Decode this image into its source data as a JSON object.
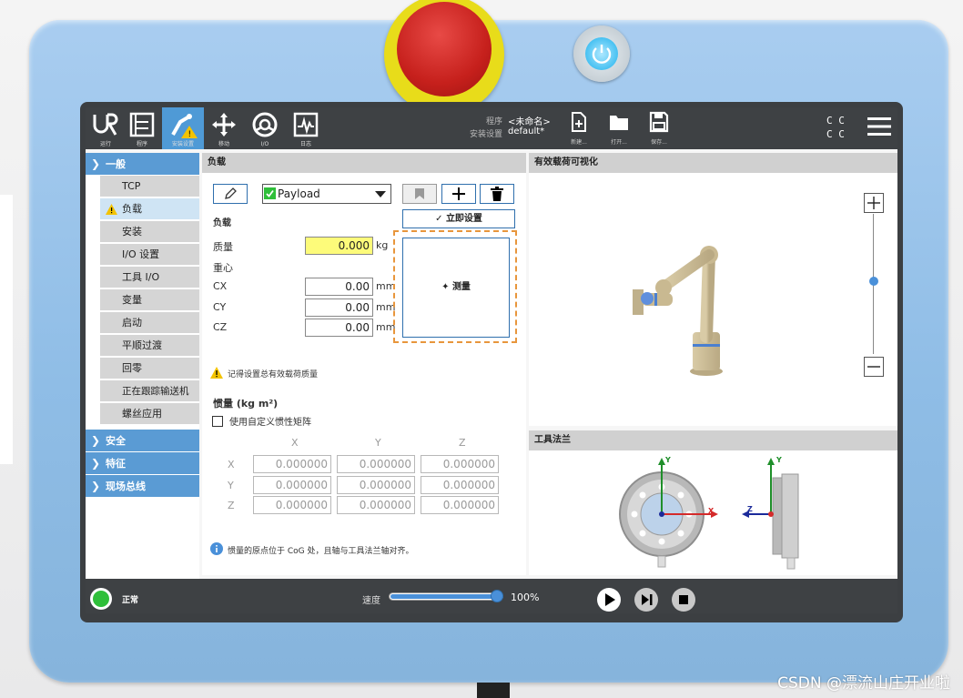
{
  "header": {
    "nav": [
      {
        "label": "运行",
        "icon": "ur-logo-icon"
      },
      {
        "label": "程序",
        "icon": "program-icon"
      },
      {
        "label": "安装设置",
        "icon": "installation-icon"
      },
      {
        "label": "移动",
        "icon": "move-icon"
      },
      {
        "label": "I/O",
        "icon": "io-icon"
      },
      {
        "label": "日志",
        "icon": "log-icon"
      }
    ],
    "program_label": "程序",
    "program_value": "<未命名>",
    "installation_label": "安装设置",
    "installation_value": "default*",
    "new_label": "新建...",
    "open_label": "打开...",
    "save_label": "保存...",
    "cc_top": "C  C",
    "cc_bottom": "C  C"
  },
  "sidebar": {
    "general": "一般",
    "items": [
      "TCP",
      "负载",
      "安装",
      "I/O 设置",
      "工具 I/O",
      "变量",
      "启动",
      "平顺过渡",
      "回零",
      "正在跟踪输送机",
      "螺丝应用"
    ],
    "selected": "负载",
    "safety": "安全",
    "features": "特征",
    "fieldbus": "现场总线"
  },
  "payload": {
    "header": "负载",
    "select_value": "Payload",
    "set_now": "立即设置",
    "section_label": "负载",
    "mass_label": "质量",
    "mass_value": "0.000",
    "mass_unit": "kg",
    "cog_label": "重心",
    "cx_label": "CX",
    "cx_value": "0.00",
    "cx_unit": "mm",
    "cy_label": "CY",
    "cy_value": "0.00",
    "cy_unit": "mm",
    "cz_label": "CZ",
    "cz_value": "0.00",
    "cz_unit": "mm",
    "measure": "测量",
    "warning": "记得设置总有效载荷质量",
    "inertia_title": "惯量 (kg m²)",
    "custom_inertia": "使用自定义惯性矩阵",
    "matrix_cols": [
      "X",
      "Y",
      "Z"
    ],
    "matrix_rows": [
      "X",
      "Y",
      "Z"
    ],
    "matrix": [
      [
        "0.000000",
        "0.000000",
        "0.000000"
      ],
      [
        "0.000000",
        "0.000000",
        "0.000000"
      ],
      [
        "0.000000",
        "0.000000",
        "0.000000"
      ]
    ],
    "info": "惯量的原点位于 CoG 处，且轴与工具法兰轴对齐。"
  },
  "viz": {
    "header": "有效载荷可视化",
    "flange_header": "工具法兰",
    "axis_y": "Y",
    "axis_x": "X",
    "axis_z": "Z"
  },
  "footer": {
    "status": "正常",
    "speed_label": "速度",
    "speed_value": "100%",
    "speed_fraction": 1.0
  },
  "watermark": "CSDN @漂流山庄开业啦",
  "colors": {
    "accent": "#5a9bd4",
    "warning": "#f3c300",
    "stop_green": "#2fbf3a"
  }
}
